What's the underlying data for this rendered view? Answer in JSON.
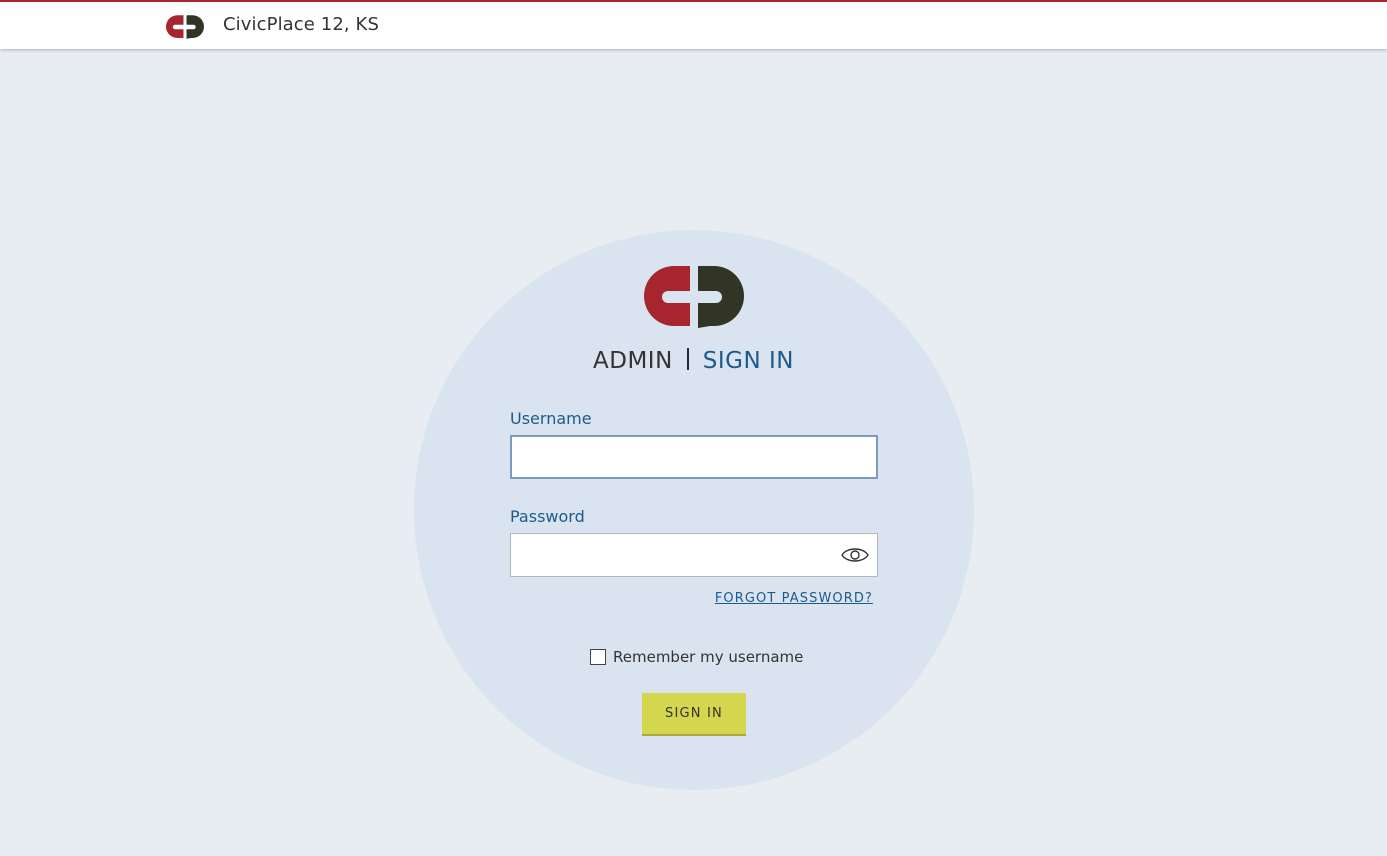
{
  "header": {
    "title": "CivicPlace 12, KS",
    "logo_icon": "civicplace-logo-icon"
  },
  "brand": {
    "logo_icon": "civicplace-logo-icon",
    "colors": {
      "red": "#a7262e",
      "dark": "#323526",
      "accent_blue": "#1f5a8a",
      "button": "#d4d64e"
    }
  },
  "login": {
    "heading_admin": "ADMIN",
    "heading_signin": "SIGN IN",
    "username_label": "Username",
    "username_value": "",
    "password_label": "Password",
    "password_value": "",
    "show_password_icon": "eye-icon",
    "forgot_password": "FORGOT PASSWORD?",
    "remember_label": "Remember my username",
    "remember_checked": false,
    "submit_label": "SIGN IN"
  }
}
